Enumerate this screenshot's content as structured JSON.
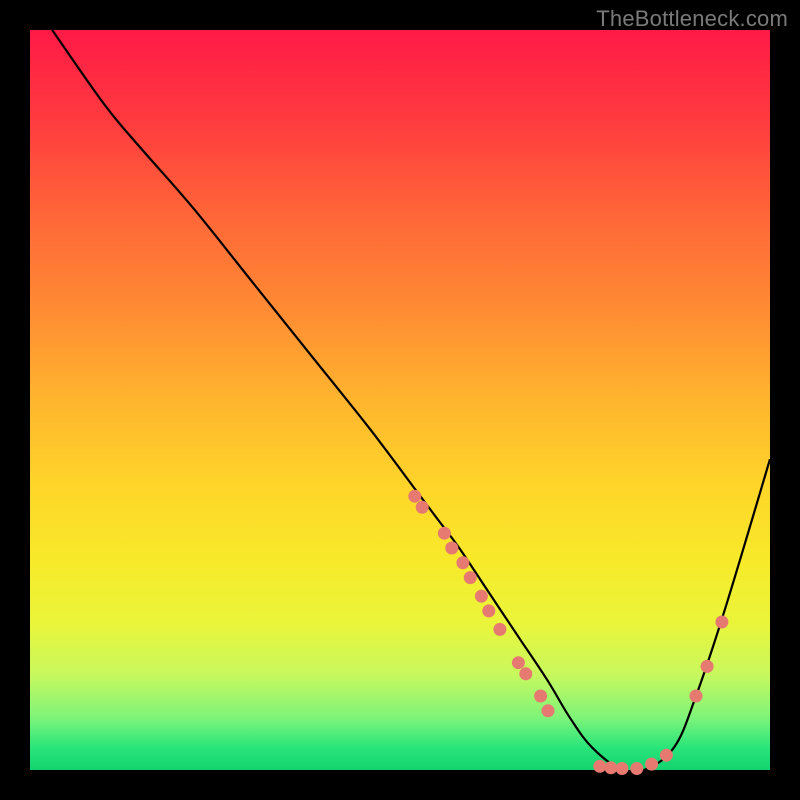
{
  "attribution": "TheBottleneck.com",
  "chart_data": {
    "type": "line",
    "title": "",
    "xlabel": "",
    "ylabel": "",
    "x_range": [
      0,
      100
    ],
    "y_range": [
      0,
      100
    ],
    "series": [
      {
        "name": "curve",
        "x": [
          3,
          10,
          15,
          22,
          30,
          38,
          46,
          52,
          55,
          58,
          62,
          66,
          70,
          73,
          76,
          80,
          83,
          87,
          90,
          94,
          100
        ],
        "y": [
          100,
          90,
          84,
          76,
          66,
          56,
          46,
          38,
          34,
          30,
          24,
          18,
          12,
          7,
          3,
          0,
          0,
          3,
          10,
          22,
          42
        ]
      }
    ],
    "markers": [
      {
        "name": "left-cluster",
        "points": [
          [
            52,
            37
          ],
          [
            53,
            35.5
          ],
          [
            56,
            32
          ],
          [
            57,
            30
          ],
          [
            58.5,
            28
          ],
          [
            59.5,
            26
          ],
          [
            61,
            23.5
          ],
          [
            62,
            21.5
          ],
          [
            63.5,
            19
          ],
          [
            66,
            14.5
          ],
          [
            67,
            13
          ],
          [
            69,
            10
          ],
          [
            70,
            8
          ]
        ]
      },
      {
        "name": "valley",
        "points": [
          [
            77,
            0.5
          ],
          [
            78.5,
            0.3
          ],
          [
            80,
            0.2
          ],
          [
            82,
            0.2
          ],
          [
            84,
            0.8
          ],
          [
            86,
            2
          ]
        ]
      },
      {
        "name": "right-branch",
        "points": [
          [
            90,
            10
          ],
          [
            91.5,
            14
          ],
          [
            93.5,
            20
          ]
        ]
      }
    ],
    "marker_radius": 6.5,
    "gradient_stops": [
      {
        "pos": 0,
        "color": "#ff1a46"
      },
      {
        "pos": 25,
        "color": "#ff6638"
      },
      {
        "pos": 50,
        "color": "#ffb52e"
      },
      {
        "pos": 75,
        "color": "#eff145"
      },
      {
        "pos": 95,
        "color": "#3be07a"
      },
      {
        "pos": 100,
        "color": "#14d36e"
      }
    ]
  }
}
